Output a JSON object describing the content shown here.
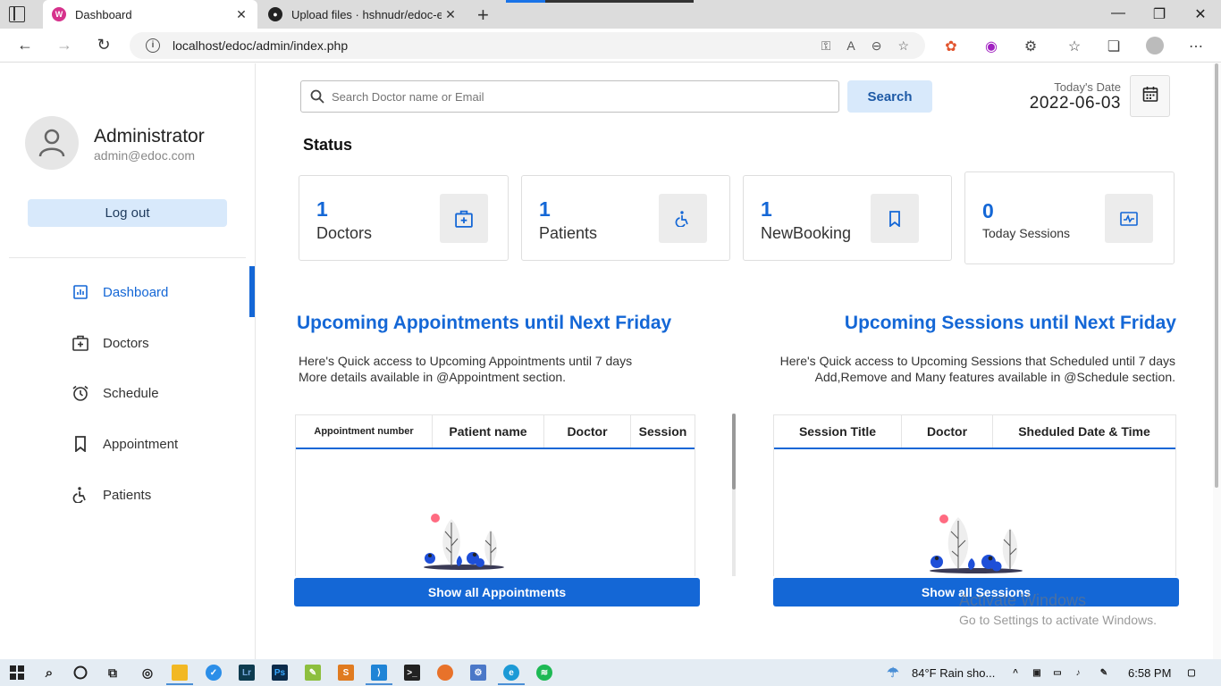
{
  "browser": {
    "tabs": [
      {
        "title": "Dashboard"
      },
      {
        "title": "Upload files · hshnudr/edoc-echa"
      }
    ],
    "url": "localhost/edoc/admin/index.php"
  },
  "sidebar": {
    "admin_name": "Administrator",
    "admin_email": "admin@edoc.com",
    "logout_label": "Log out",
    "items": [
      {
        "label": "Dashboard",
        "icon": "dashboard-icon",
        "active": true
      },
      {
        "label": "Doctors",
        "icon": "doctor-kit-icon"
      },
      {
        "label": "Schedule",
        "icon": "alarm-clock-icon"
      },
      {
        "label": "Appointment",
        "icon": "bookmark-icon"
      },
      {
        "label": "Patients",
        "icon": "wheelchair-icon"
      }
    ]
  },
  "search": {
    "placeholder": "Search Doctor name or Email",
    "button_label": "Search"
  },
  "date": {
    "label": "Today's Date",
    "value": "2022-06-03"
  },
  "status": {
    "title": "Status",
    "cards": [
      {
        "value": "1",
        "label": "Doctors",
        "icon": "doctor-kit-icon"
      },
      {
        "value": "1",
        "label": "Patients",
        "icon": "wheelchair-icon"
      },
      {
        "value": "1",
        "label": "NewBooking",
        "icon": "bookmark-icon"
      },
      {
        "value": "0",
        "label": "Today Sessions",
        "icon": "session-icon"
      }
    ]
  },
  "appointments": {
    "title": "Upcoming Appointments until Next Friday",
    "desc_line1": "Here's Quick access to Upcoming Appointments until 7 days",
    "desc_line2": "More details available in @Appointment section.",
    "columns": [
      "Appointment number",
      "Patient name",
      "Doctor",
      "Session"
    ],
    "button_label": "Show all Appointments"
  },
  "sessions": {
    "title": "Upcoming Sessions until Next Friday",
    "desc_line1": "Here's Quick access to Upcoming Sessions that Scheduled until 7 days",
    "desc_line2": "Add,Remove and Many features available in @Schedule section.",
    "columns": [
      "Session Title",
      "Doctor",
      "Sheduled Date & Time"
    ],
    "button_label": "Show all Sessions"
  },
  "watermark": {
    "line1": "Activate Windows",
    "line2": "Go to Settings to activate Windows."
  },
  "taskbar": {
    "weather": "84°F  Rain sho...",
    "time": "6:58 PM"
  },
  "colors": {
    "accent": "#1467d6",
    "light_button": "#d8e9fb"
  }
}
